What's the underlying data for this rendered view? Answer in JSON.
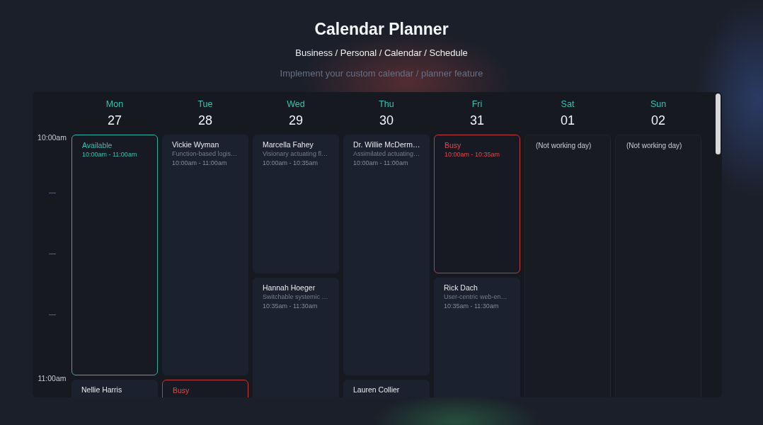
{
  "header": {
    "title": "Calendar Planner",
    "breadcrumb": "Business / Personal / Calendar / Schedule",
    "subtitle": "Implement your custom calendar / planner feature"
  },
  "calendar": {
    "time_axis": [
      {
        "kind": "label",
        "text": "10:00am"
      },
      {
        "kind": "tick"
      },
      {
        "kind": "tick"
      },
      {
        "kind": "tick"
      },
      {
        "kind": "label",
        "text": "11:00am"
      }
    ],
    "days": [
      {
        "name": "Mon",
        "date": "27",
        "events": [
          {
            "kind": "available",
            "label": "Available",
            "time": "10:00am - 11:00am"
          },
          {
            "kind": "appointment",
            "name": "Nellie Harris"
          }
        ]
      },
      {
        "name": "Tue",
        "date": "28",
        "events": [
          {
            "kind": "appointment",
            "name": "Vickie Wyman",
            "description": "Function-based logis…",
            "time": "10:00am - 11:00am"
          },
          {
            "kind": "busy",
            "label": "Busy"
          }
        ]
      },
      {
        "name": "Wed",
        "date": "29",
        "events": [
          {
            "kind": "appointment",
            "name": "Marcella Fahey",
            "description": "Visionary actuating fl…",
            "time": "10:00am - 10:35am"
          },
          {
            "kind": "appointment",
            "name": "Hannah Hoeger",
            "description": "Switchable systemic …",
            "time": "10:35am - 11:30am"
          }
        ]
      },
      {
        "name": "Thu",
        "date": "30",
        "events": [
          {
            "kind": "appointment",
            "name": "Dr. Willie McDerm…",
            "description": "Assimilated actuating…",
            "time": "10:00am - 11:00am"
          },
          {
            "kind": "appointment",
            "name": "Lauren Collier"
          }
        ]
      },
      {
        "name": "Fri",
        "date": "31",
        "events": [
          {
            "kind": "busy",
            "label": "Busy",
            "time": "10:00am - 10:35am"
          },
          {
            "kind": "appointment",
            "name": "Rick Dach",
            "description": "User-centric web-en…",
            "time": "10:35am - 11:30am"
          }
        ]
      },
      {
        "name": "Sat",
        "date": "01",
        "events": [
          {
            "kind": "off",
            "label": "(Not working day)"
          }
        ]
      },
      {
        "name": "Sun",
        "date": "02",
        "events": [
          {
            "kind": "off",
            "label": "(Not working day)"
          }
        ]
      }
    ]
  }
}
